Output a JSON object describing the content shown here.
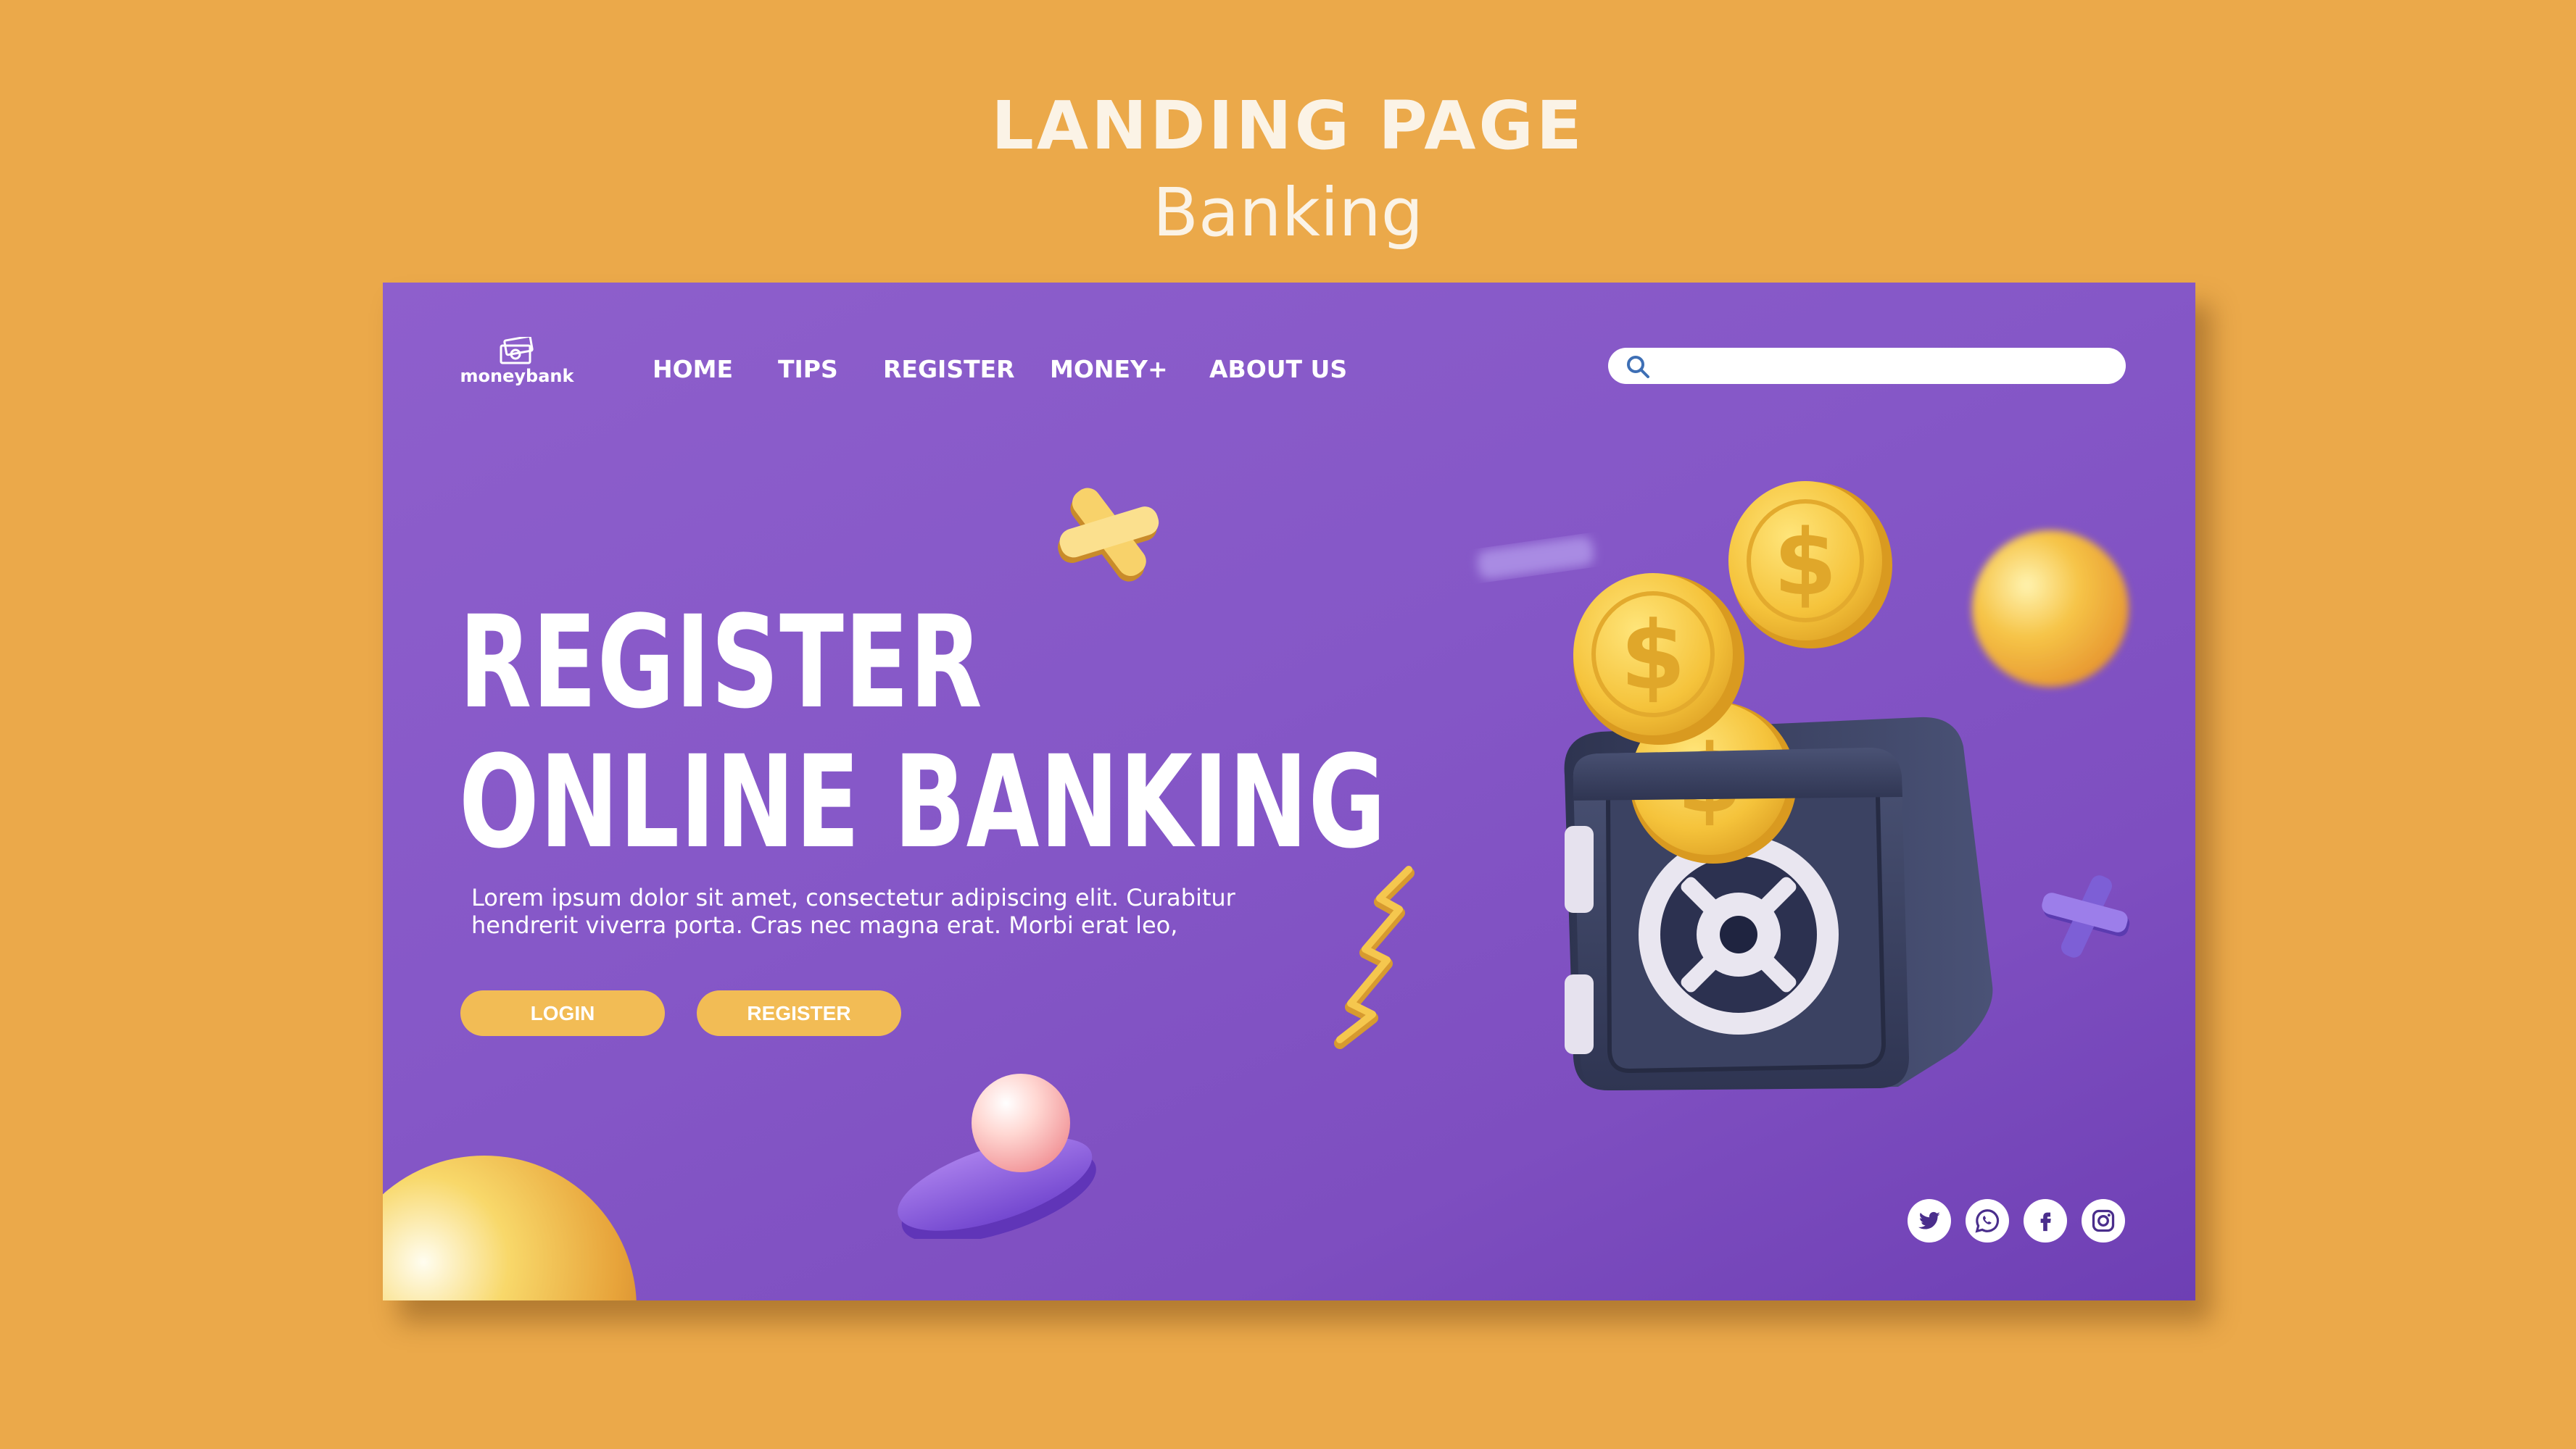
{
  "header": {
    "title": "LANDING PAGE",
    "subtitle": "Banking"
  },
  "brand": {
    "logo_text": "moneybank",
    "logo_icon": "money-bills-icon"
  },
  "nav": {
    "items": [
      {
        "label": "HOME"
      },
      {
        "label": "TIPS"
      },
      {
        "label": "REGISTER"
      },
      {
        "label": "MONEY+"
      },
      {
        "label": "ABOUT US"
      }
    ]
  },
  "search": {
    "value": "",
    "placeholder": "",
    "icon": "search-icon"
  },
  "hero": {
    "headline_line1": "REGISTER",
    "headline_line2": "ONLINE BANKING",
    "body_line1": "Lorem ipsum dolor sit amet, consectetur adipiscing elit. Curabitur",
    "body_line2": "hendrerit viverra porta. Cras nec magna erat. Morbi erat leo,"
  },
  "buttons": {
    "login_label": "LOGIN",
    "register_label": "REGISTER"
  },
  "social": [
    {
      "icon": "twitter-icon"
    },
    {
      "icon": "whatsapp-icon"
    },
    {
      "icon": "facebook-icon"
    },
    {
      "icon": "instagram-icon"
    }
  ],
  "colors": {
    "page_background": "#EBA94A",
    "panel_background": "#8557C7",
    "accent_button": "#F2BC55",
    "coin_gold": "#F5C33B",
    "safe_body": "#3D4460"
  }
}
